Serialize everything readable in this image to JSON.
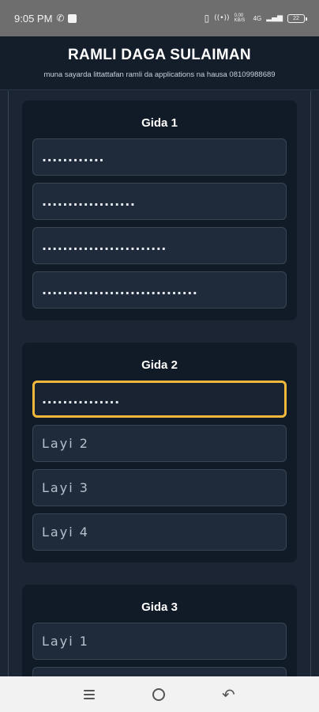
{
  "status_bar": {
    "time": "9:05 PM",
    "whatsapp_glyph": "✆",
    "vibrate_glyph": "▯",
    "hotspot_glyph": "((•))",
    "speed": "0.00 KB/S",
    "network": "4G",
    "signal": "▂▄▆",
    "battery": "22"
  },
  "header": {
    "title": "RAMLI DAGA SULAIMAN",
    "subtitle": "muna sayarda littattafan ramli da applications na hausa 08109988689"
  },
  "groups": [
    {
      "title": "Gida 1",
      "fields": [
        {
          "value": "............",
          "placeholder": ""
        },
        {
          "value": "..................",
          "placeholder": ""
        },
        {
          "value": "........................",
          "placeholder": ""
        },
        {
          "value": "..............................",
          "placeholder": ""
        }
      ]
    },
    {
      "title": "Gida 2",
      "fields": [
        {
          "value": "...............",
          "placeholder": ""
        },
        {
          "value": "",
          "placeholder": "Layi 2"
        },
        {
          "value": "",
          "placeholder": "Layi 3"
        },
        {
          "value": "",
          "placeholder": "Layi 4"
        }
      ]
    },
    {
      "title": "Gida 3",
      "fields": [
        {
          "value": "",
          "placeholder": "Layi 1"
        }
      ]
    }
  ],
  "nav": {
    "menu_icon": "menu-icon",
    "home_icon": "home-icon",
    "back_glyph": "↶"
  },
  "colors": {
    "accent_focus": "#f1b83b",
    "background": "#1c2533",
    "card": "#111a27"
  }
}
